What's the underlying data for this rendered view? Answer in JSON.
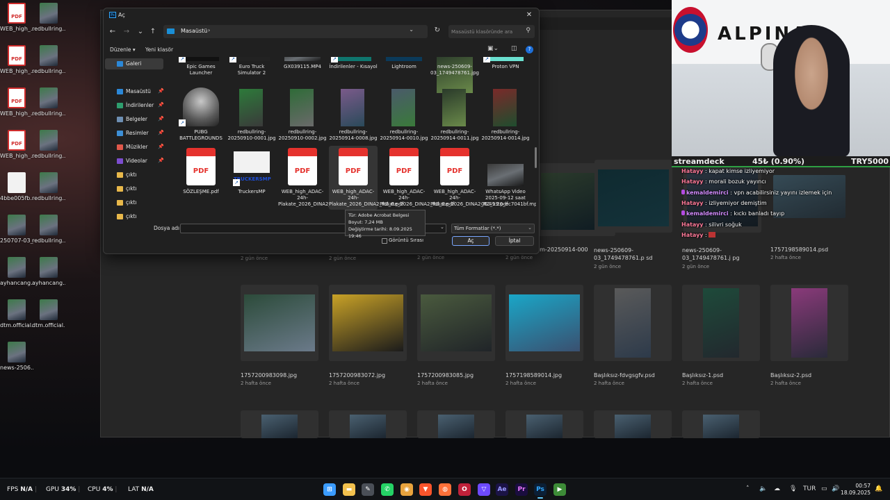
{
  "desktop": {
    "icons": [
      {
        "label": "WEB_high_...",
        "kind": "pdf"
      },
      {
        "label": "redbullring...",
        "kind": "img"
      },
      {
        "label": "WEB_high_...",
        "kind": "pdf"
      },
      {
        "label": "redbullring...",
        "kind": "img"
      },
      {
        "label": "WEB_high_...",
        "kind": "pdf"
      },
      {
        "label": "redbullring...",
        "kind": "img"
      },
      {
        "label": "WEB_high_...",
        "kind": "pdf"
      },
      {
        "label": "redbullring...",
        "kind": "img"
      },
      {
        "label": "4bbe005fb...",
        "kind": "doc"
      },
      {
        "label": "redbullring...",
        "kind": "img"
      },
      {
        "label": "250707-03_...",
        "kind": "img"
      },
      {
        "label": "redbullring...",
        "kind": "img"
      },
      {
        "label": "ayhancang...",
        "kind": "img"
      },
      {
        "label": "ayhancang...",
        "kind": "img"
      },
      {
        "label": "dtm.official...",
        "kind": "img"
      },
      {
        "label": "dtm.official...",
        "kind": "img"
      },
      {
        "label": "news-2506...",
        "kind": "img"
      }
    ]
  },
  "photoshop": {
    "row1_names": [
      "2 gün önce",
      "2 gün önce",
      "1.psd",
      "1.jpg",
      "news-250609-03_1749478761.p sd",
      "news-250609-03_1749478761.j pg",
      "1757198589014.psd"
    ],
    "row1_times": [
      "",
      "",
      "2 gün önce",
      "2 gün önce",
      "2 gün önce",
      "2 gün önce",
      "2 hafta önce"
    ],
    "row1_extra": "gm-20250914-000",
    "row2": [
      {
        "name": "1757200983098.jpg",
        "time": "2 hafta önce"
      },
      {
        "name": "1757200983072.jpg",
        "time": "2 hafta önce"
      },
      {
        "name": "1757200983085.jpg",
        "time": "2 hafta önce"
      },
      {
        "name": "1757198589014.jpg",
        "time": "2 hafta önce"
      },
      {
        "name": "Başlıksız-fdvgsgfv.psd",
        "time": "2 hafta önce"
      },
      {
        "name": "Başlıksız-1.psd",
        "time": "2 hafta önce"
      },
      {
        "name": "Başlıksız-2.psd",
        "time": "2 hafta önce"
      }
    ]
  },
  "dialog": {
    "title": "Aç",
    "close": "✕",
    "path": "Masaüstü",
    "search_placeholder": "Masaüstü klasöründe ara",
    "organize": "Düzenle ▾",
    "new_folder": "Yeni klasör",
    "sidebar": [
      {
        "label": "Galeri",
        "color": "#2b88d8",
        "pinned": false
      },
      {
        "label": "Masaüstü",
        "color": "#2b88d8",
        "pinned": true
      },
      {
        "label": "İndirilenler",
        "color": "#2e9e6e",
        "pinned": true
      },
      {
        "label": "Belgeler",
        "color": "#6d8fb3",
        "pinned": true
      },
      {
        "label": "Resimler",
        "color": "#3d8fd6",
        "pinned": true
      },
      {
        "label": "Müzikler",
        "color": "#e0584b",
        "pinned": true
      },
      {
        "label": "Videolar",
        "color": "#7c4dcf",
        "pinned": true
      },
      {
        "label": "çıktı",
        "color": "#e8b84a",
        "pinned": false
      },
      {
        "label": "çıktı",
        "color": "#e8b84a",
        "pinned": false
      },
      {
        "label": "çıktı",
        "color": "#e8b84a",
        "pinned": false
      },
      {
        "label": "çıktı",
        "color": "#e8b84a",
        "pinned": false
      }
    ],
    "files_row1": [
      {
        "name": "Epic Games Launcher",
        "kind": "app"
      },
      {
        "name": "Euro Truck Simulator 2",
        "kind": "app"
      },
      {
        "name": "GX039115.MP4",
        "kind": "video"
      },
      {
        "name": "İndirilenler - Kısayol",
        "kind": "app"
      },
      {
        "name": "Lightroom",
        "kind": "app"
      },
      {
        "name": "news-250609-03_1749478761.jpg",
        "kind": "img"
      },
      {
        "name": "Proton VPN",
        "kind": "app"
      }
    ],
    "files_row2": [
      {
        "name": "PUBG BATTLEGROUNDS",
        "kind": "pubg"
      },
      {
        "name": "redbullring-20250910-0001.jpg",
        "kind": "img"
      },
      {
        "name": "redbullring-20250910-0002.jpg",
        "kind": "img"
      },
      {
        "name": "redbullring-20250914-0008.jpg",
        "kind": "img"
      },
      {
        "name": "redbullring-20250914-0010.jpg",
        "kind": "img"
      },
      {
        "name": "redbullring-20250914-0011.jpg",
        "kind": "img"
      },
      {
        "name": "redbullring-20250914-0014.jpg",
        "kind": "img"
      }
    ],
    "files_row3": [
      {
        "name": "SÖZLEŞME.pdf",
        "kind": "pdf"
      },
      {
        "name": "TruckersMP",
        "kind": "truck"
      },
      {
        "name": "WEB_high_ADAC-24h-Plakate_2026_DINA2_RZ_5.pdf",
        "kind": "pdf"
      },
      {
        "name": "WEB_high_ADAC-24h-Plakate_2026_DINA2_RZ_6.pdf",
        "kind": "pdf"
      },
      {
        "name": "WEB_high_ADAC-24h-Plakate_2026_DINA2_RZ_9.pdf",
        "kind": "pdf"
      },
      {
        "name": "WEB_high_ADAC-24h-Plakate_2026_DINA2_RZ_19.pdf",
        "kind": "pdf"
      },
      {
        "name": "WhatsApp Video 2025-09-12 saat 00.49.20_ec7041bf.mp4",
        "kind": "video"
      }
    ],
    "pdf_label": "PDF",
    "truckers_label": "TRUCKERSMP",
    "tooltip": {
      "type": "Tür: Adobe Acrobat Belgesi",
      "size": "Boyut: 7,24 MB",
      "modified": "Değiştirme tarihi: 8.09.2025 19:46"
    },
    "filename_label": "Dosya adı:",
    "filename_value": "",
    "filter": "Tüm Formatlar (*.*)",
    "image_sequence": "Görüntü Sırası",
    "open": "Aç",
    "cancel": "İptal"
  },
  "stream": {
    "name": "streamdeck",
    "stat": "45₺ (0.90%)",
    "currency": "TRY5000",
    "banner_text": "ALPINA",
    "chat": [
      {
        "user": "Hatayy",
        "text": " : kapat kimse izliyemiyor",
        "badge": false
      },
      {
        "user": "Hatayy",
        "text": " : morali bozuk yayıncı",
        "badge": false
      },
      {
        "user": "kemaldemirci",
        "text": " : vpn acabilirsiniz yayını izlemek için",
        "badge": true
      },
      {
        "user": "Hatayy",
        "text": " : izliyemiyor demiştim",
        "badge": false
      },
      {
        "user": "kemaldemirci",
        "text": " : kıckı banladı tayıp",
        "badge": true
      },
      {
        "user": "Hatayy",
        "text": " : silivri soğuk",
        "badge": false
      },
      {
        "user": "Hatayy",
        "text": " : ",
        "badge": false
      }
    ]
  },
  "taskbar": {
    "fps_label": "FPS",
    "fps_value": "N/A",
    "gpu_label": "GPU",
    "gpu_value": "34%",
    "cpu_label": "CPU",
    "cpu_value": "4%",
    "lat_label": "LAT",
    "lat_value": "N/A",
    "apps": [
      {
        "name": "start",
        "glyph": "⊞",
        "color": "#3b9cff",
        "active": false
      },
      {
        "name": "explorer",
        "glyph": "▬",
        "color": "#f2c14e",
        "active": false
      },
      {
        "name": "notes",
        "glyph": "✎",
        "color": "#4a4f57",
        "active": false
      },
      {
        "name": "whatsapp",
        "glyph": "✆",
        "color": "#25d366",
        "active": false
      },
      {
        "name": "chrome",
        "glyph": "◉",
        "color": "#e8a33d",
        "active": false
      },
      {
        "name": "brave",
        "glyph": "▼",
        "color": "#fb542b",
        "active": false
      },
      {
        "name": "firefox",
        "glyph": "◍",
        "color": "#ff7139",
        "active": false
      },
      {
        "name": "opera",
        "glyph": "O",
        "color": "#c0213a",
        "active": false
      },
      {
        "name": "proton",
        "glyph": "▽",
        "color": "#6d4aff",
        "active": false
      },
      {
        "name": "aftereffects",
        "glyph": "Ae",
        "color": "#1b1346",
        "active": false
      },
      {
        "name": "premiere",
        "glyph": "Pr",
        "color": "#1a0d3f",
        "active": false
      },
      {
        "name": "photoshop",
        "glyph": "Ps",
        "color": "#0b1f35",
        "active": true
      },
      {
        "name": "media",
        "glyph": "▶",
        "color": "#3d8b37",
        "active": false
      }
    ],
    "lang": "TUR",
    "time": "00:57",
    "date": "18.09.2025"
  }
}
